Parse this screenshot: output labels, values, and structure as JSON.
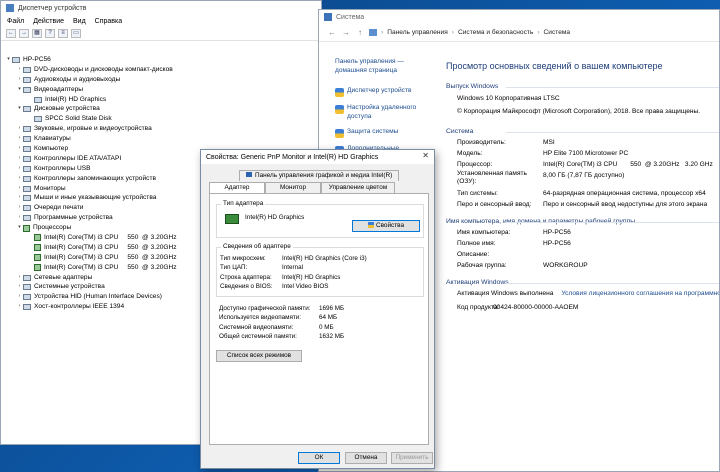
{
  "devmgr": {
    "title": "Диспетчер устройств",
    "menu": [
      "Файл",
      "Действие",
      "Вид",
      "Справка"
    ],
    "tree": [
      {
        "level": 0,
        "exp": "▾",
        "label": "HP-PC56",
        "icon": "computer-icon"
      },
      {
        "level": 1,
        "exp": "›",
        "label": "DVD-дисководы и дисководы компакт-дисков",
        "icon": "dvd-drive-icon"
      },
      {
        "level": 1,
        "exp": "›",
        "label": "Аудиовходы и аудиовыходы",
        "icon": "audio-icon"
      },
      {
        "level": 1,
        "exp": "▾",
        "label": "Видеоадаптеры",
        "icon": "display-adapter-icon"
      },
      {
        "level": 2,
        "exp": "",
        "label": "Intel(R) HD Graphics",
        "icon": "display-adapter-icon"
      },
      {
        "level": 1,
        "exp": "▾",
        "label": "Дисковые устройства",
        "icon": "disk-icon"
      },
      {
        "level": 2,
        "exp": "",
        "label": "SPCC Solid State Disk",
        "icon": "disk-icon"
      },
      {
        "level": 1,
        "exp": "›",
        "label": "Звуковые, игровые и видеоустройства",
        "icon": "sound-icon"
      },
      {
        "level": 1,
        "exp": "›",
        "label": "Клавиатуры",
        "icon": "keyboard-icon"
      },
      {
        "level": 1,
        "exp": "›",
        "label": "Компьютер",
        "icon": "computer-icon"
      },
      {
        "level": 1,
        "exp": "›",
        "label": "Контроллеры IDE ATA/ATAPI",
        "icon": "ide-controller-icon"
      },
      {
        "level": 1,
        "exp": "›",
        "label": "Контроллеры USB",
        "icon": "usb-icon"
      },
      {
        "level": 1,
        "exp": "›",
        "label": "Контроллеры запоминающих устройств",
        "icon": "storage-controller-icon"
      },
      {
        "level": 1,
        "exp": "›",
        "label": "Мониторы",
        "icon": "monitor-icon"
      },
      {
        "level": 1,
        "exp": "›",
        "label": "Мыши и иные указывающие устройства",
        "icon": "mouse-icon"
      },
      {
        "level": 1,
        "exp": "›",
        "label": "Очереди печати",
        "icon": "printer-icon"
      },
      {
        "level": 1,
        "exp": "›",
        "label": "Программные устройства",
        "icon": "software-device-icon"
      },
      {
        "level": 1,
        "exp": "▾",
        "label": "Процессоры",
        "icon": "cpu-icon"
      },
      {
        "level": 2,
        "exp": "",
        "label": "Intel(R) Core(TM) i3 CPU",
        "extra": "550  @ 3.20GHz",
        "icon": "cpu-icon"
      },
      {
        "level": 2,
        "exp": "",
        "label": "Intel(R) Core(TM) i3 CPU",
        "extra": "550  @ 3.20GHz",
        "icon": "cpu-icon"
      },
      {
        "level": 2,
        "exp": "",
        "label": "Intel(R) Core(TM) i3 CPU",
        "extra": "550  @ 3.20GHz",
        "icon": "cpu-icon"
      },
      {
        "level": 2,
        "exp": "",
        "label": "Intel(R) Core(TM) i3 CPU",
        "extra": "550  @ 3.20GHz",
        "icon": "cpu-icon"
      },
      {
        "level": 1,
        "exp": "›",
        "label": "Сетевые адаптеры",
        "icon": "network-icon"
      },
      {
        "level": 1,
        "exp": "›",
        "label": "Системные устройства",
        "icon": "system-device-icon"
      },
      {
        "level": 1,
        "exp": "›",
        "label": "Устройства HID (Human Interface Devices)",
        "icon": "hid-icon"
      },
      {
        "level": 1,
        "exp": "›",
        "label": "Хост-контроллеры IEEE 1394",
        "icon": "ieee1394-icon"
      }
    ]
  },
  "system": {
    "title": "Система",
    "breadcrumb": [
      "Панель управления",
      "Система и безопасность",
      "Система"
    ],
    "left_home": "Панель управления — домашняя страница",
    "left_links": [
      "Диспетчер устройств",
      "Настройка удаленного доступа",
      "Защита системы",
      "Дополнительные параметры системы"
    ],
    "heading": "Просмотр основных сведений о вашем компьютере",
    "edition_title": "Выпуск Windows",
    "edition_lines": [
      "Windows 10 Корпоративная LTSC",
      "© Корпорация Майкрософт (Microsoft Corporation), 2018. Все права защищены."
    ],
    "system_title": "Система",
    "system_rows": [
      {
        "k": "Производитель:",
        "v": "MSI"
      },
      {
        "k": "Модель:",
        "v": "HP Elite 7100 Microtower PC"
      },
      {
        "k": "Процессор:",
        "v": "Intel(R) Core(TM) i3 CPU       550  @ 3.20GHz   3.20 GHz"
      },
      {
        "k": "Установленная память (ОЗУ):",
        "v": "8,00 ГБ (7,87 ГБ доступно)"
      },
      {
        "k": "Тип системы:",
        "v": "64-разрядная операционная система, процессор x64"
      },
      {
        "k": "Перо и сенсорный ввод:",
        "v": "Перо и сенсорный ввод недоступны для этого экрана"
      }
    ],
    "name_title": "Имя компьютера, имя домена и параметры рабочей группы",
    "name_rows": [
      {
        "k": "Имя компьютера:",
        "v": "HP-PC56"
      },
      {
        "k": "Полное имя:",
        "v": "HP-PC56"
      },
      {
        "k": "Описание:",
        "v": ""
      },
      {
        "k": "Рабочая группа:",
        "v": "WORKGROUP"
      }
    ],
    "activation_title": "Активация Windows",
    "activation_status": "Активация Windows выполнена",
    "activation_link": "Условия лицензионного соглашения на программное обеспечение",
    "product_key_label": "Код продукта:",
    "product_key": "00424-80000-00000-AAOEM"
  },
  "props": {
    "title": "Свойства: Generic PnP Monitor и Intel(R) HD Graphics",
    "tab_top": "Панель управления графикой и медиа Intel(R)",
    "tabs": [
      "Адаптер",
      "Монитор",
      "Управление цветом"
    ],
    "adapter_type_label": "Тип адаптера",
    "adapter_name": "Intel(R) HD Graphics",
    "properties_button": "Свойства",
    "info_label": "Сведения об адаптере",
    "info_rows": [
      {
        "k": "Тип микросхем:",
        "v": "Intel(R) HD Graphics (Core i3)"
      },
      {
        "k": "Тип ЦАП:",
        "v": "Internal"
      },
      {
        "k": "Строка адаптера:",
        "v": "Intel(R) HD Graphics"
      },
      {
        "k": "Сведения о BIOS:",
        "v": "Intel Video BIOS"
      }
    ],
    "mem_rows": [
      {
        "k": "Доступно графической памяти:",
        "v": "1696 МБ"
      },
      {
        "k": "Используется видеопамяти:",
        "v": "64 МБ"
      },
      {
        "k": "Системной видеопамяти:",
        "v": "0 МБ"
      },
      {
        "k": "Общей системной памяти:",
        "v": "1632 МБ"
      }
    ],
    "list_modes_button": "Список всех режимов",
    "ok": "ОК",
    "cancel": "Отмена",
    "apply": "Применить"
  },
  "watermark": "Avito"
}
